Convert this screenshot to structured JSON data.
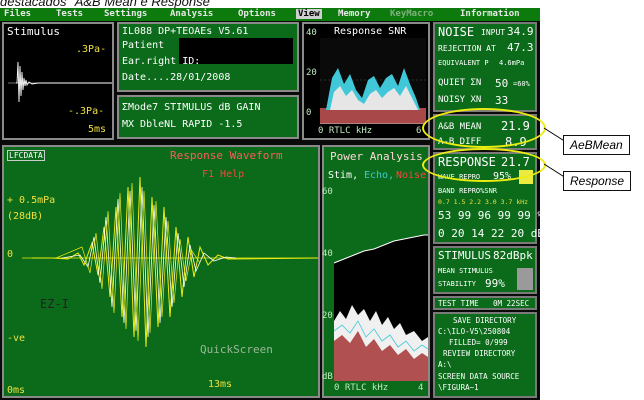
{
  "caption": "destacados \"A&B Mean e Response\"",
  "menu": {
    "items": [
      {
        "label": "Files"
      },
      {
        "label": "Tests"
      },
      {
        "label": "Settings"
      },
      {
        "label": "Analysis"
      },
      {
        "label": "Options"
      },
      {
        "label": "View"
      },
      {
        "label": "Memory"
      },
      {
        "label": "KeyMacro"
      },
      {
        "label": "Information"
      }
    ]
  },
  "stimulus": {
    "title": "Stimulus",
    "top_label": ".3Pa-",
    "bottom_label": "-.3Pa-",
    "time_label": "5ms"
  },
  "info": {
    "line1": "IL088 DP+TEOAEs  V5.61",
    "line2": "Patient",
    "line3": "Ear.right ID:",
    "line4": "Date....28/01/2008"
  },
  "mode": {
    "line1": "ΣMode7 STIMULUS dB GAIN",
    "line2": "MX DbleNL RAPID   -1.5"
  },
  "snr": {
    "title": "Response SNR",
    "y_top": "40",
    "y_mid": "20",
    "y_bot": "0",
    "x_label": "0 RTLC kHz",
    "x_end": "6"
  },
  "waveform": {
    "tag": "LFCDATA",
    "title": "Response Waveform",
    "help": "F1 Help",
    "scale": "+ 0.5mPa",
    "db": "(28dB)",
    "zero": "0",
    "neg": "-ve",
    "start": "0ms",
    "end": "13ms",
    "overlay1": "EZ-I",
    "overlay2": "QuickScreen"
  },
  "power": {
    "title": "Power Analysis",
    "legend_stim": "Stim,",
    "legend_echo": "Echo,",
    "legend_noise": "Noise",
    "y_60": "60",
    "y_40": "40",
    "y_20": "20",
    "y_0": "0",
    "y_db": "dB",
    "x_label": "0 RTLC kHz",
    "x_end": "4"
  },
  "noise_box": {
    "title": "NOISE",
    "title_sub": "INPUT",
    "title_value": "34.9",
    "rejection_label": "REJECTION AT",
    "rejection_value": "47.3",
    "equivalent_label": "EQUIVALENT P",
    "equivalent_value": "4.6mPa",
    "quiet_label": "QUIET ΣN",
    "quiet_value": "50",
    "quiet_unit": "=60%",
    "noisy_label": "NOISY XN",
    "noisy_value": "33"
  },
  "ab_box": {
    "mean_label": "A&B MEAN",
    "mean_value": "21.9",
    "diff_label": "A-B DIFF",
    "diff_value": "8.9"
  },
  "response_box": {
    "title": "RESPONSE",
    "value": "21.7",
    "wave_repro_label": "WAVE REPRO",
    "wave_repro_value": "95%",
    "band_label": "BAND REPRO%SNR",
    "freq_row": "0.7 1.5 2.2 3.0 3.7 kHz",
    "repro_row": "53 99 96 99 99 %",
    "snr_row": "0 20 14 22 20 dB"
  },
  "stimulus_box": {
    "title": "STIMULUS",
    "value": "82dBpk",
    "mean_label": "MEAN STIMULUS",
    "stability_label": "STABILITY",
    "stability_value": "99%"
  },
  "test_time": {
    "label": "TEST TIME",
    "value": "0M 22SEC"
  },
  "save_box": {
    "line1": "SAVE DIRECTORY",
    "line2": "C:\\ILO-V5\\250804",
    "line3": "FILLED=  0/999",
    "line4": "REVIEW DIRECTORY",
    "line5": "A:\\",
    "line6": "SCREEN DATA SOURCE",
    "line7": "\\FIGURA~1"
  },
  "callouts": {
    "mean": "AeBMean",
    "response": "Response"
  },
  "colors": {
    "accent_green": "#0b6b1a",
    "highlight_yellow": "#ecec12",
    "wave_yellow": "#f0e040",
    "noise_red": "#b04848",
    "echo_cyan": "#40c8d8"
  }
}
